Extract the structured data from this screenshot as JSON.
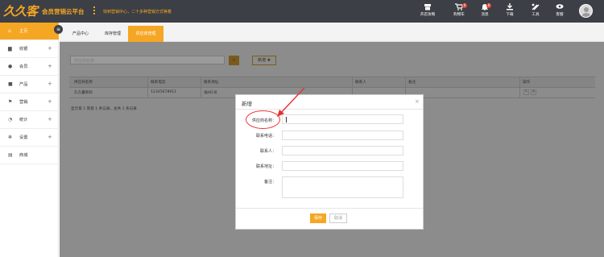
{
  "header": {
    "logo_text": "久久客",
    "brand": "会员营销云平台",
    "tagline": "快到营销中心，二十多种营销方式等着",
    "buttons": [
      {
        "label": "开店攻略",
        "icon": "store-icon",
        "badge": ""
      },
      {
        "label": "购物车",
        "icon": "cart-icon",
        "badge": "0"
      },
      {
        "label": "消息",
        "icon": "bell-icon",
        "badge": "0"
      },
      {
        "label": "下载",
        "icon": "download-icon",
        "badge": ""
      },
      {
        "label": "工具",
        "icon": "tools-icon",
        "badge": ""
      },
      {
        "label": "客服",
        "icon": "service-icon",
        "badge": ""
      }
    ]
  },
  "sidebar": {
    "items": [
      {
        "label": "主页",
        "icon": "home-icon",
        "expandable": false,
        "active": true
      },
      {
        "label": "收银",
        "icon": "monitor-icon",
        "expandable": true,
        "active": false
      },
      {
        "label": "会员",
        "icon": "users-icon",
        "expandable": true,
        "active": false
      },
      {
        "label": "产品",
        "icon": "box-icon",
        "expandable": true,
        "active": false
      },
      {
        "label": "营销",
        "icon": "flag-icon",
        "expandable": true,
        "active": false
      },
      {
        "label": "统计",
        "icon": "chart-icon",
        "expandable": true,
        "active": false
      },
      {
        "label": "设置",
        "icon": "gear-icon",
        "expandable": true,
        "active": false
      },
      {
        "label": "商城",
        "icon": "shop-icon",
        "expandable": false,
        "active": false
      }
    ],
    "plus": "+"
  },
  "tabs": [
    {
      "label": "产品中心",
      "active": false
    },
    {
      "label": "库存管理",
      "active": false
    },
    {
      "label": "供应商管理",
      "active": true
    }
  ],
  "toolbar": {
    "search_placeholder": "供应商名称",
    "new_label": "新增 ✚"
  },
  "table": {
    "columns": [
      "供应商名称",
      "联系电话",
      "联系地址",
      "联系人",
      "备注",
      "操作"
    ],
    "rows": [
      {
        "name": "久久囊商科",
        "phone": "12345678911",
        "address": "福州1号",
        "contact": "",
        "note": ""
      }
    ],
    "pager": "显示第 1 到第 1 条记录，总共 1 条记录"
  },
  "modal": {
    "title": "新增",
    "close": "×",
    "fields": [
      {
        "label": "供应商名称：",
        "value": ""
      },
      {
        "label": "联系电话：",
        "value": ""
      },
      {
        "label": "联系人：",
        "value": ""
      },
      {
        "label": "联系地址：",
        "value": ""
      },
      {
        "label": "备注：",
        "value": ""
      }
    ],
    "save_label": "保存",
    "cancel_label": "取消"
  },
  "colors": {
    "accent": "#f5a623",
    "topbar": "#3c3f45",
    "annotation": "#e33333"
  }
}
